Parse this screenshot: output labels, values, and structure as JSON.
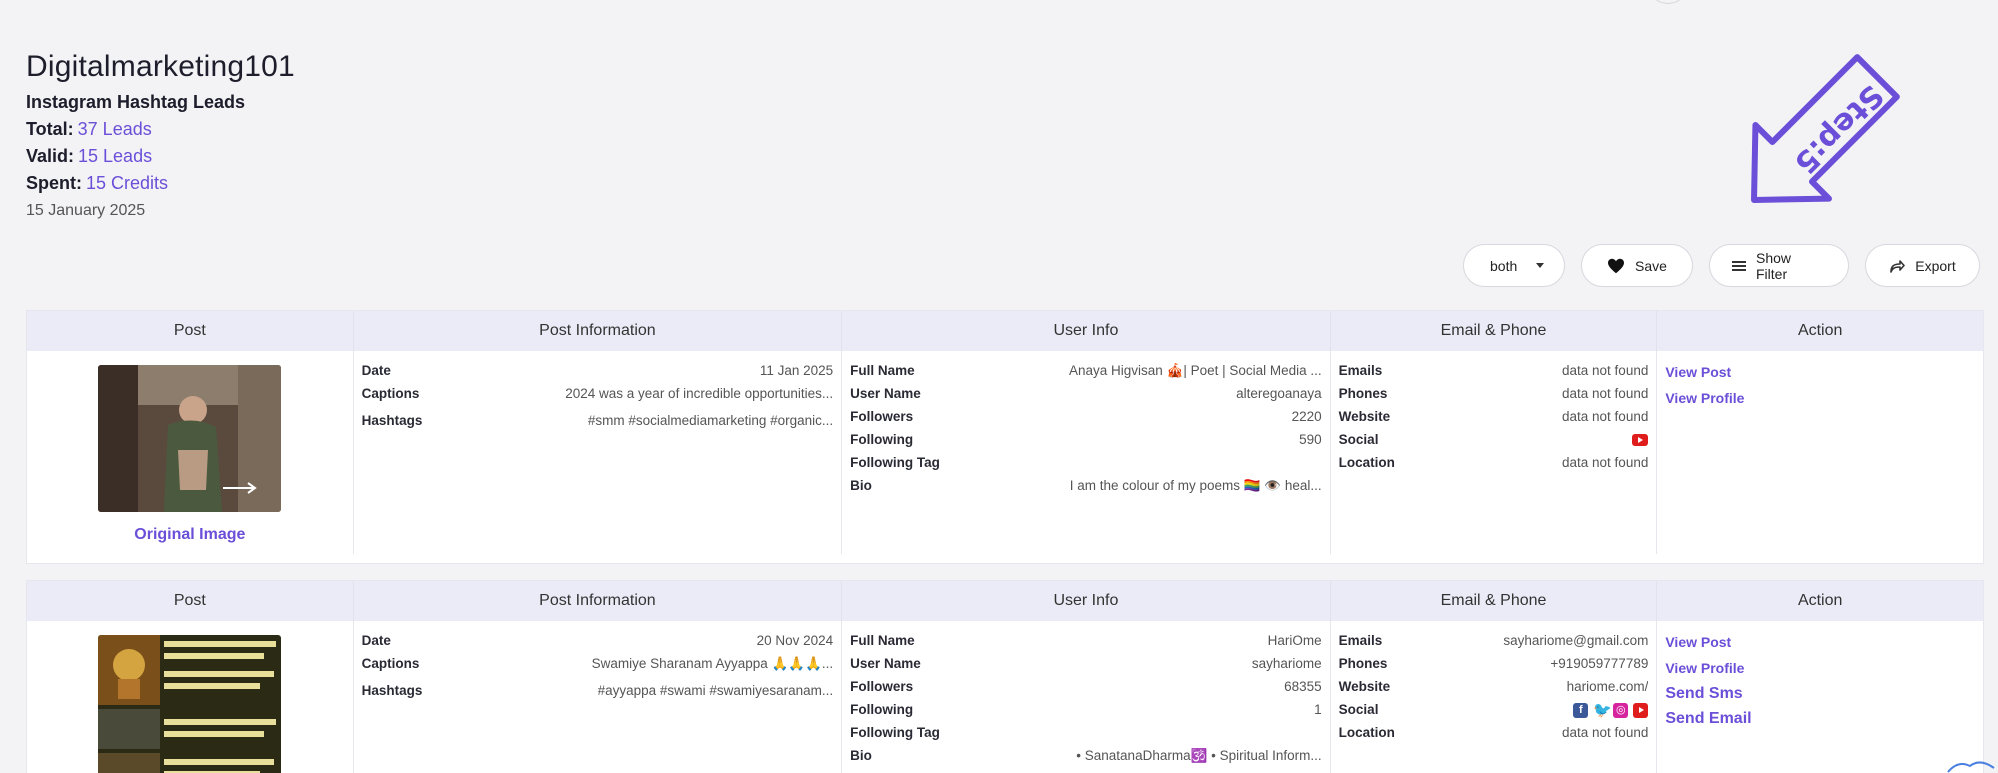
{
  "header": {
    "title": "Digitalmarketing101",
    "subtitle": "Instagram Hashtag Leads",
    "total_label": "Total:",
    "total_value": "37 Leads",
    "valid_label": "Valid:",
    "valid_value": "15 Leads",
    "spent_label": "Spent:",
    "spent_value": "15 Credits",
    "date": "15 January 2025"
  },
  "annotation": {
    "text": "Step:5",
    "color": "#6b4fd8"
  },
  "toolbar": {
    "filter_select": "both",
    "save_label": "Save",
    "show_filter_label": "Show Filter",
    "export_label": "Export"
  },
  "columns": {
    "post": "Post",
    "post_info": "Post Information",
    "user_info": "User Info",
    "email_phone": "Email & Phone",
    "action": "Action"
  },
  "labels": {
    "date": "Date",
    "captions": "Captions",
    "hashtags": "Hashtags",
    "full_name": "Full Name",
    "user_name": "User Name",
    "followers": "Followers",
    "following": "Following",
    "following_tag": "Following Tag",
    "bio": "Bio",
    "emails": "Emails",
    "phones": "Phones",
    "website": "Website",
    "social": "Social",
    "location": "Location",
    "original_image": "Original Image",
    "view_post": "View Post",
    "view_profile": "View Profile",
    "send_sms": "Send Sms",
    "send_email": "Send Email"
  },
  "rows": [
    {
      "date": "11 Jan 2025",
      "captions": "2024 was a year of incredible opportunities...",
      "hashtags": "#smm #socialmediamarketing #organic...",
      "full_name": "Anaya Higvisan 🎪| Poet | Social Media ...",
      "user_name": "alteregoanaya",
      "followers": "2220",
      "following": "590",
      "following_tag": "",
      "bio": "I am the colour of my poems 🏳️‍🌈 👁️ heal...",
      "emails": "data not found",
      "phones": "data not found",
      "website": "data not found",
      "social": [
        "youtube-icon"
      ],
      "location": "data not found"
    },
    {
      "date": "20 Nov 2024",
      "captions": "Swamiye Sharanam Ayyappa 🙏🙏🙏...",
      "hashtags": "#ayyappa #swami #swamiyesaranam...",
      "full_name": "HariOme",
      "user_name": "sayhariome",
      "followers": "68355",
      "following": "1",
      "following_tag": "",
      "bio": "• SanatanaDharma🕉️ • Spiritual Inform...",
      "emails": "sayhariome@gmail.com",
      "phones": "+919059777789",
      "website": "hariome.com/",
      "social": [
        "facebook-icon",
        "twitter-icon",
        "instagram-icon",
        "youtube-icon"
      ],
      "location": "data not found"
    }
  ]
}
